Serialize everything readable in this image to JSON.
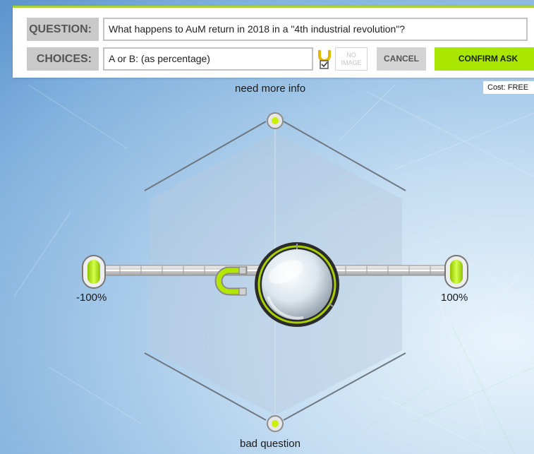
{
  "question": {
    "label": "QUESTION:",
    "value": "What happens to AuM return in 2018 in a \"4th industrial revolution\"?"
  },
  "choices": {
    "label": "CHOICES:",
    "value": "A or B:  (as percentage)"
  },
  "buttons": {
    "no_image_line1": "NO",
    "no_image_line2": "IMAGE",
    "cancel": "CANCEL",
    "confirm": "CONFIRM ASK"
  },
  "cost": "Cost: FREE",
  "board": {
    "top_label": "need more info",
    "bottom_label": "bad question",
    "left_label": "-100%",
    "right_label": "100%"
  },
  "colors": {
    "accent_green": "#a9e600",
    "panel_border": "#a8d334",
    "label_gray": "#c9c9c9"
  },
  "icons": {
    "magnet": "magnet-icon",
    "checkbox": "checkbox-icon",
    "lens": "magnifier-lens-icon"
  }
}
